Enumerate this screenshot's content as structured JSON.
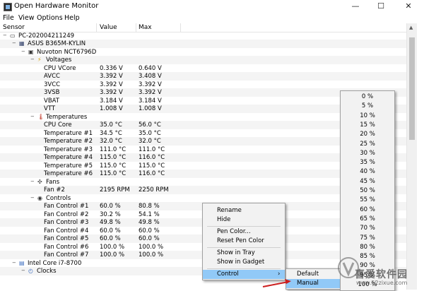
{
  "window": {
    "title": "Open Hardware Monitor",
    "min": "—",
    "max": "☐",
    "close": "✕"
  },
  "menu": [
    "File",
    "View",
    "Options",
    "Help"
  ],
  "columns": {
    "sensor": "Sensor",
    "value": "Value",
    "max": "Max"
  },
  "rows": [
    {
      "label": "PC-202004211249",
      "value": "",
      "max": "",
      "indent": 0,
      "icon": "computer-icon",
      "expander": "minus"
    },
    {
      "label": "ASUS B365M-KYLIN",
      "value": "",
      "max": "",
      "indent": 1,
      "icon": "mainboard-icon",
      "expander": "minus"
    },
    {
      "label": "Nuvoton NCT6796D",
      "value": "",
      "max": "",
      "indent": 2,
      "icon": "chip-icon",
      "expander": "minus"
    },
    {
      "label": "Voltages",
      "value": "",
      "max": "",
      "indent": 3,
      "icon": "voltage-icon",
      "expander": "minus"
    },
    {
      "label": "CPU VCore",
      "value": "0.336 V",
      "max": "0.640 V",
      "indent": 4,
      "icon": "",
      "expander": ""
    },
    {
      "label": "AVCC",
      "value": "3.392 V",
      "max": "3.408 V",
      "indent": 4,
      "icon": "",
      "expander": ""
    },
    {
      "label": "3VCC",
      "value": "3.392 V",
      "max": "3.392 V",
      "indent": 4,
      "icon": "",
      "expander": ""
    },
    {
      "label": "3VSB",
      "value": "3.392 V",
      "max": "3.392 V",
      "indent": 4,
      "icon": "",
      "expander": ""
    },
    {
      "label": "VBAT",
      "value": "3.184 V",
      "max": "3.184 V",
      "indent": 4,
      "icon": "",
      "expander": ""
    },
    {
      "label": "VTT",
      "value": "1.008 V",
      "max": "1.008 V",
      "indent": 4,
      "icon": "",
      "expander": ""
    },
    {
      "label": "Temperatures",
      "value": "",
      "max": "",
      "indent": 3,
      "icon": "thermometer-icon",
      "expander": "minus"
    },
    {
      "label": "CPU Core",
      "value": "35.0 °C",
      "max": "56.0 °C",
      "indent": 4,
      "icon": "",
      "expander": ""
    },
    {
      "label": "Temperature #1",
      "value": "34.5 °C",
      "max": "35.0 °C",
      "indent": 4,
      "icon": "",
      "expander": ""
    },
    {
      "label": "Temperature #2",
      "value": "32.0 °C",
      "max": "32.0 °C",
      "indent": 4,
      "icon": "",
      "expander": ""
    },
    {
      "label": "Temperature #3",
      "value": "111.0 °C",
      "max": "111.0 °C",
      "indent": 4,
      "icon": "",
      "expander": ""
    },
    {
      "label": "Temperature #4",
      "value": "115.0 °C",
      "max": "116.0 °C",
      "indent": 4,
      "icon": "",
      "expander": ""
    },
    {
      "label": "Temperature #5",
      "value": "115.0 °C",
      "max": "115.0 °C",
      "indent": 4,
      "icon": "",
      "expander": ""
    },
    {
      "label": "Temperature #6",
      "value": "115.0 °C",
      "max": "116.0 °C",
      "indent": 4,
      "icon": "",
      "expander": ""
    },
    {
      "label": "Fans",
      "value": "",
      "max": "",
      "indent": 3,
      "icon": "fan-icon",
      "expander": "minus"
    },
    {
      "label": "Fan #2",
      "value": "2195 RPM",
      "max": "2250 RPM",
      "indent": 4,
      "icon": "",
      "expander": ""
    },
    {
      "label": "Controls",
      "value": "",
      "max": "",
      "indent": 3,
      "icon": "control-icon",
      "expander": "minus"
    },
    {
      "label": "Fan Control #1",
      "value": "60.0 %",
      "max": "80.8 %",
      "indent": 4,
      "icon": "",
      "expander": ""
    },
    {
      "label": "Fan Control #2",
      "value": "30.2 %",
      "max": "54.1 %",
      "indent": 4,
      "icon": "",
      "expander": ""
    },
    {
      "label": "Fan Control #3",
      "value": "49.8 %",
      "max": "49.8 %",
      "indent": 4,
      "icon": "",
      "expander": ""
    },
    {
      "label": "Fan Control #4",
      "value": "60.0 %",
      "max": "60.0 %",
      "indent": 4,
      "icon": "",
      "expander": ""
    },
    {
      "label": "Fan Control #5",
      "value": "60.0 %",
      "max": "60.0 %",
      "indent": 4,
      "icon": "",
      "expander": ""
    },
    {
      "label": "Fan Control #6",
      "value": "100.0 %",
      "max": "100.0 %",
      "indent": 4,
      "icon": "",
      "expander": ""
    },
    {
      "label": "Fan Control #7",
      "value": "100.0 %",
      "max": "100.0 %",
      "indent": 4,
      "icon": "",
      "expander": ""
    },
    {
      "label": "Intel Core i7-8700",
      "value": "",
      "max": "",
      "indent": 1,
      "icon": "cpu-icon",
      "expander": "minus"
    },
    {
      "label": "Clocks",
      "value": "",
      "max": "",
      "indent": 2,
      "icon": "clock-icon",
      "expander": "minus"
    }
  ],
  "context_menu": {
    "items": [
      "Rename",
      "Hide",
      "Pen Color...",
      "Reset Pen Color",
      "Show in Tray",
      "Show in Gadget",
      "Control"
    ],
    "highlighted": "Control",
    "submenu_arrow": "›"
  },
  "submenu": {
    "items": [
      "Default",
      "Manual"
    ],
    "highlighted": "Manual"
  },
  "percent_menu": {
    "items": [
      "0 %",
      "5 %",
      "10 %",
      "15 %",
      "20 %",
      "25 %",
      "30 %",
      "35 %",
      "40 %",
      "45 %",
      "50 %",
      "55 %",
      "60 %",
      "65 %",
      "70 %",
      "75 %",
      "80 %",
      "85 %",
      "90 %",
      "95 %",
      "100 %"
    ]
  },
  "watermark": {
    "text": "喜爱软件园",
    "url": "www.52zixue.com"
  },
  "colors": {
    "highlight": "#91c9f7",
    "arrow": "#cc1f1f"
  }
}
